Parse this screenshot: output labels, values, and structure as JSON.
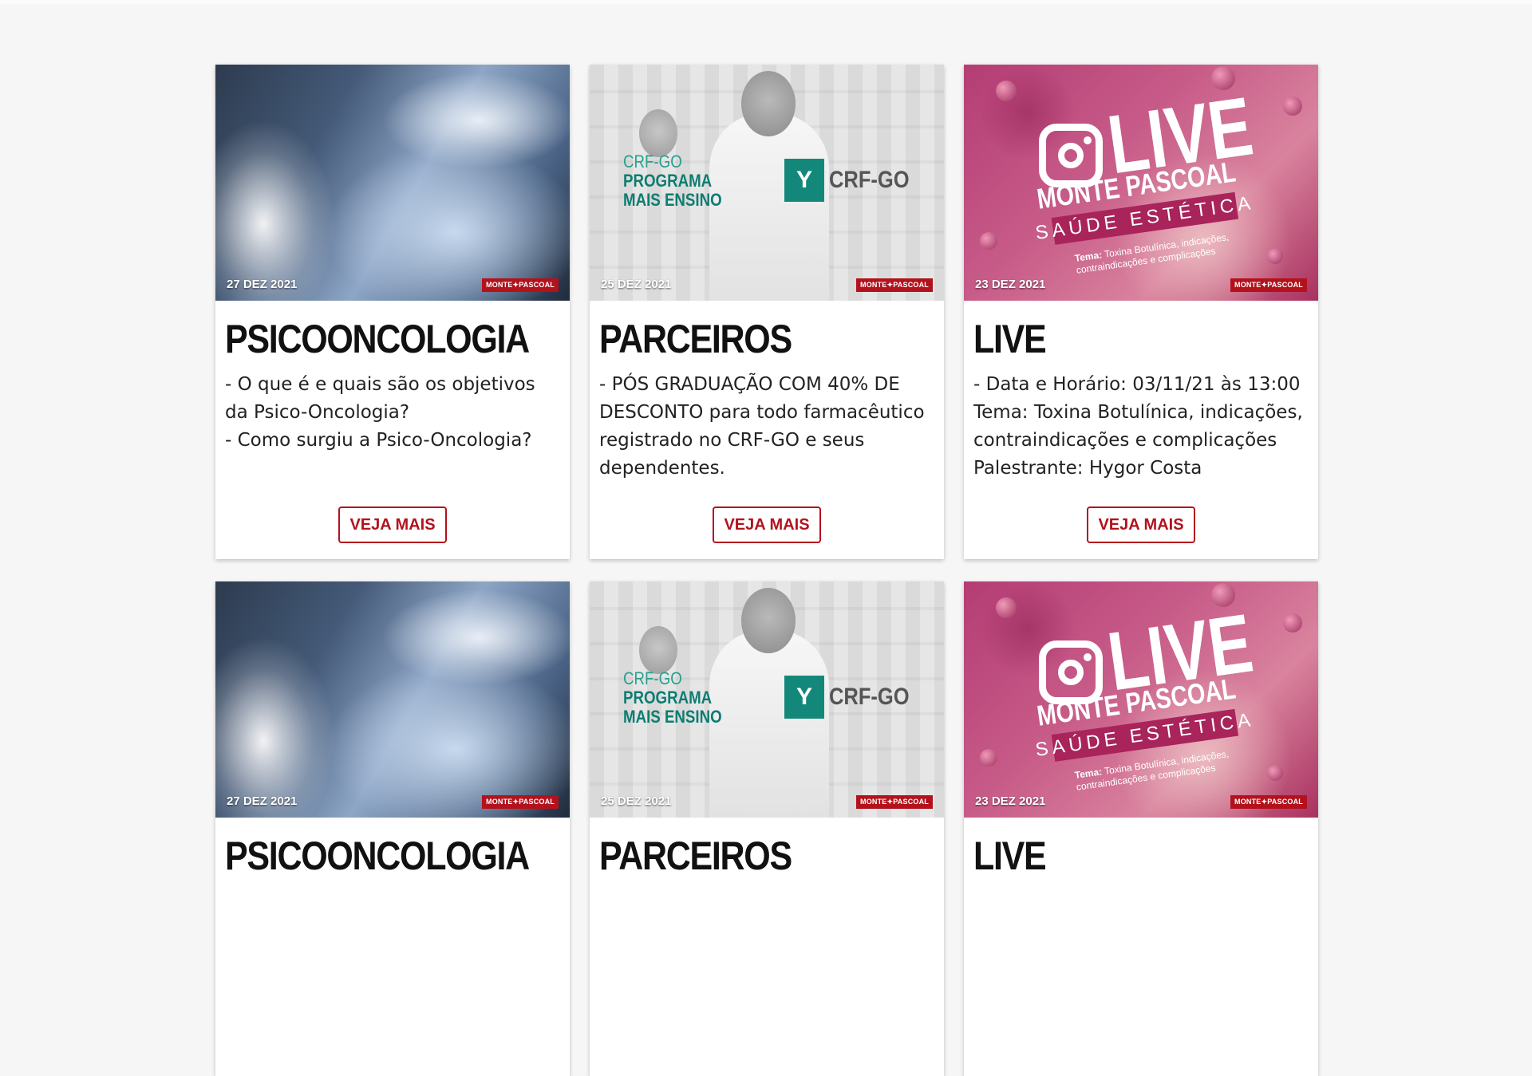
{
  "cards": [
    {
      "date": "27 DEZ 2021",
      "brand": "MONTE✦PASCOAL",
      "title": "PSICOONCOLOGIA",
      "lines": [
        "- O que é e quais são os objetivos da Psico-Oncologia?",
        "- Como surgiu a Psico-Oncologia?"
      ],
      "button": "VEJA MAIS",
      "image": "hospital-patient-photo"
    },
    {
      "date": "25 DEZ 2021",
      "brand": "MONTE✦PASCOAL",
      "title": "PARCEIROS",
      "lines": [
        "- PÓS GRADUAÇÃO COM 40% DE DESCONTO para todo farmacêutico registrado no CRF-GO e seus dependentes."
      ],
      "button": "VEJA MAIS",
      "image": "pharmacy-program-banner",
      "image_text": {
        "line1": "CRF-GO",
        "line2": "PROGRAMA",
        "line3": "MAIS ENSINO",
        "logo": "CRF-GO"
      }
    },
    {
      "date": "23 DEZ 2021",
      "brand": "MONTE✦PASCOAL",
      "title": "LIVE",
      "lines": [
        "- Data e Horário: 03/11/21 às 13:00",
        "Tema: Toxina Botulínica, indicações, contraindicações e complicações",
        "Palestrante: Hygor Costa"
      ],
      "button": "VEJA MAIS",
      "image": "live-instagram-banner",
      "image_text": {
        "live": "LIVE",
        "name": "MONTE PASCOAL",
        "band": "SAÚDE ESTÉTICA",
        "tema_label": "Tema:",
        "tema_text": "Toxina Botulínica, indicações,",
        "tema_text2": "contraindicações e complicações"
      }
    },
    {
      "date": "27 DEZ 2021",
      "brand": "MONTE✦PASCOAL",
      "title": "PSICOONCOLOGIA",
      "lines": [],
      "button": "",
      "image": "hospital-patient-photo"
    },
    {
      "date": "25 DEZ 2021",
      "brand": "MONTE✦PASCOAL",
      "title": "PARCEIROS",
      "lines": [],
      "button": "",
      "image": "pharmacy-program-banner",
      "image_text": {
        "line1": "CRF-GO",
        "line2": "PROGRAMA",
        "line3": "MAIS ENSINO",
        "logo": "CRF-GO"
      }
    },
    {
      "date": "23 DEZ 2021",
      "brand": "MONTE✦PASCOAL",
      "title": "LIVE",
      "lines": [],
      "button": "",
      "image": "live-instagram-banner",
      "image_text": {
        "live": "LIVE",
        "name": "MONTE PASCOAL",
        "band": "SAÚDE ESTÉTICA",
        "tema_label": "Tema:",
        "tema_text": "Toxina Botulínica, indicações,",
        "tema_text2": "contraindicações e complicações"
      }
    }
  ],
  "colors": {
    "accent": "#b3121c",
    "background": "#f6f6f6",
    "card": "#ffffff"
  }
}
